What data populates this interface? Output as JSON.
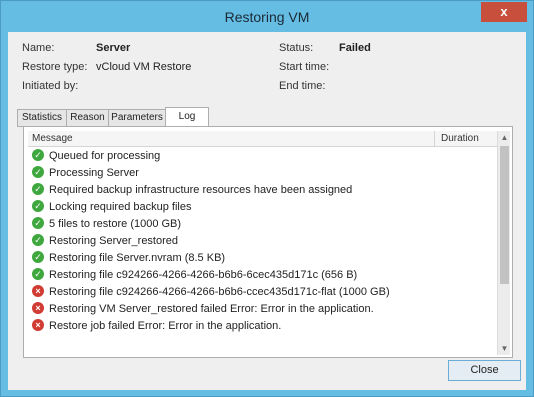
{
  "window": {
    "title": "Restoring VM",
    "close_glyph": "x"
  },
  "info": {
    "name_label": "Name:",
    "name_value": "Server",
    "restore_type_label": "Restore type:",
    "restore_type_value": "vCloud VM Restore",
    "initiated_by_label": "Initiated by:",
    "status_label": "Status:",
    "status_value": "Failed",
    "start_time_label": "Start time:",
    "end_time_label": "End time:"
  },
  "tabs": [
    {
      "label": "Statistics"
    },
    {
      "label": "Reason"
    },
    {
      "label": "Parameters"
    },
    {
      "label": "Log"
    }
  ],
  "grid": {
    "col_message": "Message",
    "col_duration": "Duration"
  },
  "log": [
    {
      "status": "ok",
      "text": "Queued for processing"
    },
    {
      "status": "ok",
      "text": "Processing Server"
    },
    {
      "status": "ok",
      "text": "Required backup infrastructure resources have been assigned"
    },
    {
      "status": "ok",
      "text": "Locking required backup files"
    },
    {
      "status": "ok",
      "text": "5 files to restore (1000 GB)"
    },
    {
      "status": "ok",
      "text": "Restoring Server_restored"
    },
    {
      "status": "ok",
      "text": "Restoring file Server.nvram (8.5 KB)"
    },
    {
      "status": "ok",
      "text": "Restoring file   c924266-4266-4266-b6b6-6cec435d171c (656 B)"
    },
    {
      "status": "err",
      "text": "Restoring file   c924266-4266-4266-b6b6-ccec435d171c-flat (1000 GB)"
    },
    {
      "status": "err",
      "text": "Restoring VM Server_restored failed Error: Error in the application."
    },
    {
      "status": "err",
      "text": "Restore job failed Error: Error in the application."
    }
  ],
  "buttons": {
    "close": "Close"
  },
  "colors": {
    "ok": "#3ea73e",
    "err": "#d03b33",
    "titlebar": "#66bde4"
  }
}
